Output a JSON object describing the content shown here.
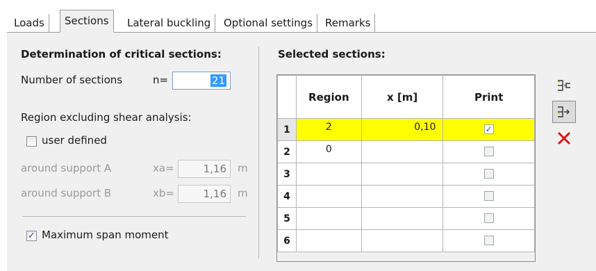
{
  "tabs": [
    {
      "label": "Loads"
    },
    {
      "label": "Sections"
    },
    {
      "label": "Lateral buckling"
    },
    {
      "label": "Optional settings"
    },
    {
      "label": "Remarks"
    }
  ],
  "left": {
    "heading": "Determination of critical sections:",
    "num_sections_label": "Number of sections",
    "n_label": "n=",
    "n_value": "21",
    "region_label": "Region excluding shear analysis:",
    "user_defined_label": "user defined",
    "user_defined_checked": false,
    "support_a_label": "around support A",
    "xa_label": "xa=",
    "xa_value": "1,16",
    "xa_unit": "m",
    "support_b_label": "around support B",
    "xb_label": "xb=",
    "xb_value": "1,16",
    "xb_unit": "m",
    "max_span_label": "Maximum span moment",
    "max_span_checked": true
  },
  "right": {
    "heading": "Selected sections:",
    "columns": [
      "Region",
      "x [m]",
      "Print"
    ],
    "rows": [
      {
        "num": "1",
        "region": "2",
        "x": "0,10",
        "print": true,
        "selected": true
      },
      {
        "num": "2",
        "region": "0",
        "x": "",
        "print": false,
        "selected": false
      },
      {
        "num": "3",
        "region": "",
        "x": "",
        "print": false,
        "selected": false
      },
      {
        "num": "4",
        "region": "",
        "x": "",
        "print": false,
        "selected": false
      },
      {
        "num": "5",
        "region": "",
        "x": "",
        "print": false,
        "selected": false
      },
      {
        "num": "6",
        "region": "",
        "x": "",
        "print": false,
        "selected": false
      }
    ]
  },
  "toolbar": {
    "buttons": [
      {
        "icon": "insert-row-icon"
      },
      {
        "icon": "append-row-icon"
      },
      {
        "icon": "delete-row-icon",
        "color": "#e01010"
      }
    ]
  }
}
